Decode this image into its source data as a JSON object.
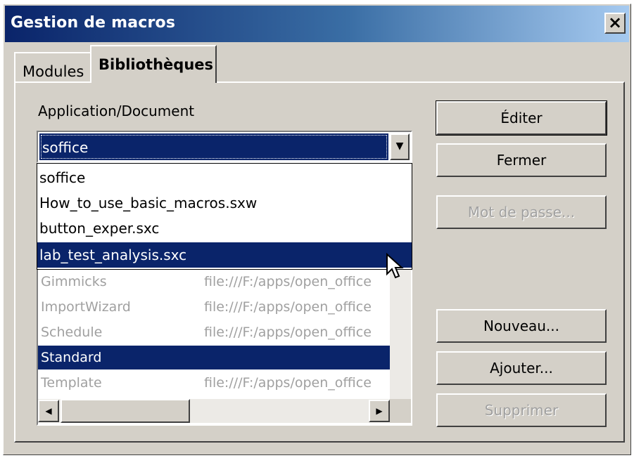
{
  "window": {
    "title": "Gestion de macros",
    "close_label": "×"
  },
  "tabs": [
    {
      "label": "Modules",
      "active": false
    },
    {
      "label": "Bibliothèques",
      "active": true
    }
  ],
  "application_document": {
    "label": "Application/Document",
    "selected_value": "soffice",
    "dropdown_options": [
      "soffice",
      "How_to_use_basic_macros.sxw",
      "button_exper.sxc",
      "lab_test_analysis.sxc"
    ],
    "highlighted_option": "lab_test_analysis.sxc"
  },
  "libraries": {
    "rows": [
      {
        "name": "Gimmicks",
        "path": "file:///F:/apps/open_office"
      },
      {
        "name": "ImportWizard",
        "path": "file:///F:/apps/open_office"
      },
      {
        "name": "Schedule",
        "path": "file:///F:/apps/open_office"
      },
      {
        "name": "Standard",
        "path": ""
      },
      {
        "name": "Template",
        "path": "file:///F:/apps/open_office"
      }
    ],
    "selected": "Standard"
  },
  "buttons": {
    "edit": "Éditer",
    "close": "Fermer",
    "password": "Mot de passe...",
    "new": "Nouveau...",
    "add": "Ajouter...",
    "delete": "Supprimer"
  },
  "colors": {
    "selection": "#0a246a",
    "dialog_bg": "#d4d0c8",
    "disabled_text": "#a0a0a0"
  }
}
